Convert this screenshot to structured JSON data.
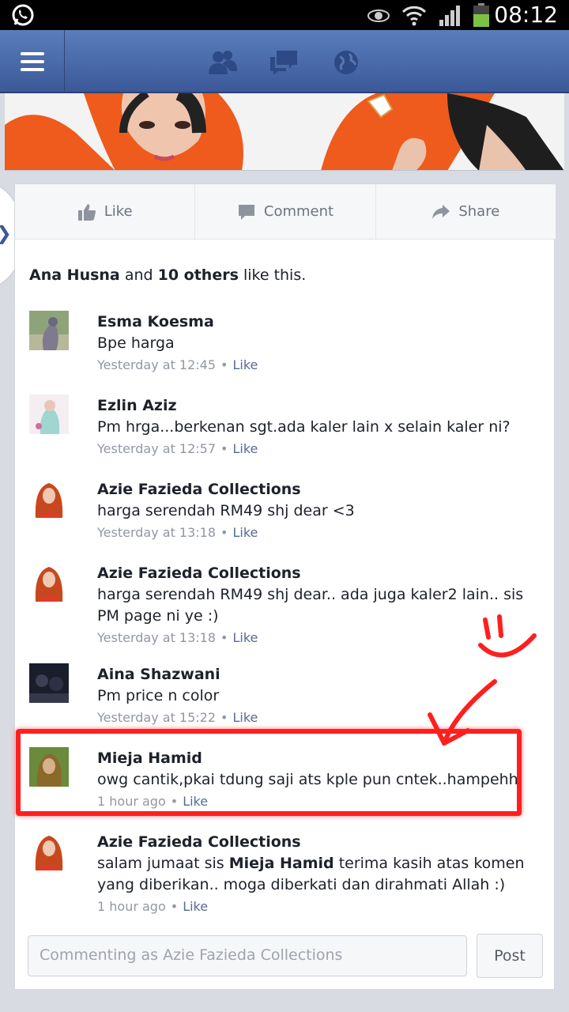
{
  "status_bar": {
    "time": "08:12"
  },
  "colors": {
    "facebook_blue": "#3b5998",
    "highlight_red": "#ff1f1f",
    "link": "#576b95"
  },
  "actions": [
    {
      "label": "Like",
      "icon": "thumbs-up-icon"
    },
    {
      "label": "Comment",
      "icon": "comment-icon"
    },
    {
      "label": "Share",
      "icon": "share-icon"
    }
  ],
  "likes": {
    "name": "Ana Husna",
    "and": "and",
    "others": "10 others",
    "suffix": "like this."
  },
  "comments": [
    {
      "author": "Esma Koesma",
      "text": "Bpe harga",
      "time": "Yesterday at 12:45",
      "like": "Like"
    },
    {
      "author": "Ezlin Aziz",
      "text": "Pm hrga...berkenan sgt.ada kaler lain x selain kaler ni?",
      "time": "Yesterday at 12:57",
      "like": "Like"
    },
    {
      "author": "Azie Fazieda Collections",
      "text": "harga serendah RM49 shj dear <3",
      "time": "Yesterday at 13:18",
      "like": "Like"
    },
    {
      "author": "Azie Fazieda Collections",
      "text": "harga serendah RM49 shj dear.. ada juga kaler2 lain.. sis PM page ni ye :)",
      "time": "Yesterday at 13:18",
      "like": "Like"
    },
    {
      "author": "Aina Shazwani",
      "text": "Pm price n color",
      "time": "Yesterday at 15:22",
      "like": "Like"
    },
    {
      "author": "Mieja Hamid",
      "text": "owg cantik,pkai tdung saji ats kple pun cntek..hampehh",
      "time": "1 hour ago",
      "like": "Like"
    },
    {
      "author": "Azie Fazieda Collections",
      "text_before": "salam jumaat sis",
      "mention": "Mieja Hamid",
      "text_after": "terima kasih atas komen yang diberikan.. moga diberkati dan dirahmati Allah :)",
      "time": "1 hour ago",
      "like": "Like"
    }
  ],
  "composer": {
    "placeholder": "Commenting as Azie Fazieda Collections",
    "post_label": "Post"
  }
}
